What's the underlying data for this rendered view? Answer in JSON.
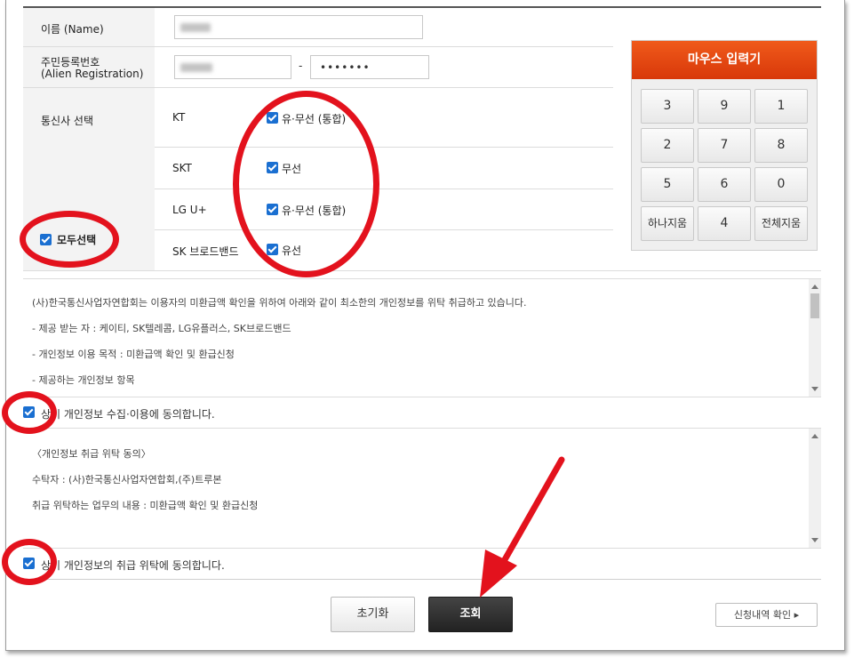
{
  "form": {
    "name_label": "이름 (Name)",
    "reg_label": "주민등록번호",
    "reg_label_en": "(Alien Registration)",
    "reg_separator": "-",
    "reg_back_masked": "•••••••",
    "carrier_label": "통신사 선택",
    "select_all_label": "모두선택",
    "carriers": [
      {
        "name": "KT",
        "option": "유·무선 (통합)",
        "checked": true
      },
      {
        "name": "SKT",
        "option": "무선",
        "checked": true
      },
      {
        "name": "LG U+",
        "option": "유·무선 (통합)",
        "checked": true
      },
      {
        "name": "SK 브로드밴드",
        "option": "유선",
        "checked": true
      }
    ]
  },
  "keypad": {
    "title": "마우스 입력기",
    "keys": [
      "3",
      "9",
      "1",
      "2",
      "7",
      "8",
      "5",
      "6",
      "0",
      "하나지움",
      "4",
      "전체지움"
    ]
  },
  "terms1": {
    "lines": [
      "(사)한국통신사업자연합회는 이용자의 미환급액 확인을 위하여 아래와 같이 최소한의 개인정보를 위탁 취급하고 있습니다.",
      "- 제공 받는 자 : 케이티, SK텔레콤, LG유플러스, SK브로드밴드",
      "- 개인정보 이용 목적 : 미환급액 확인 및 환급신청",
      "- 제공하는 개인정보 항목"
    ],
    "agree_text": "상기 개인정보 수집·이용에 동의합니다."
  },
  "terms2": {
    "lines": [
      "〈개인정보 취급 위탁 동의〉",
      "수탁자 : (사)한국통신사업자연합회,(주)트루본",
      "취급 위탁하는 업무의 내용 : 미환급액 확인 및 환급신청"
    ],
    "agree_text": "상기 개인정보의 취급 위탁에 동의합니다."
  },
  "buttons": {
    "reset": "초기화",
    "submit": "조회",
    "history": "신청내역 확인 ▸"
  },
  "colors": {
    "annotation_red": "#e3121d",
    "keypad_header": "#e84a12",
    "checkbox_blue": "#1a6fd1",
    "submit_bg": "#2b2b2b"
  }
}
